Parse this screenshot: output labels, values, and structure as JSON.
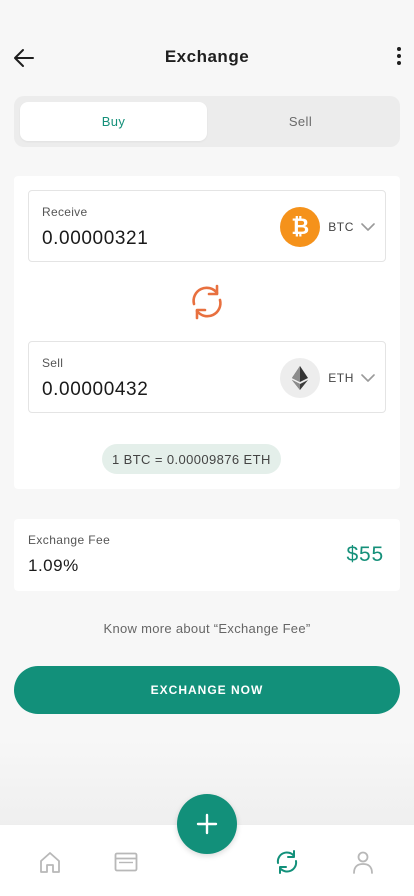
{
  "header": {
    "title": "Exchange",
    "back_icon": "arrow-left-icon",
    "more_icon": "more-vertical-icon"
  },
  "tabs": [
    {
      "label": "Buy",
      "active": true
    },
    {
      "label": "Sell",
      "active": false
    }
  ],
  "receive": {
    "label": "Receive",
    "value": "0.00000321",
    "coin_symbol": "BTC",
    "coin_icon": "bitcoin-icon",
    "coin_glyph": "₿"
  },
  "sell": {
    "label": "Sell",
    "value": "0.00000432",
    "coin_symbol": "ETH",
    "coin_icon": "ethereum-icon"
  },
  "swap_icon": "swap-refresh-icon",
  "rate": "1 BTC = 0.00009876 ETH",
  "fee": {
    "label": "Exchange Fee",
    "rate": "1.09%",
    "amount": "$55"
  },
  "know_more": "Know more about “Exchange Fee”",
  "exchange_button": "EXCHANGE NOW",
  "bottom_nav": {
    "items": [
      {
        "icon": "home-icon",
        "active": false
      },
      {
        "icon": "wallet-card-icon",
        "active": false
      },
      {
        "icon": "exchange-refresh-icon",
        "active": true
      },
      {
        "icon": "profile-icon",
        "active": false
      }
    ],
    "fab_icon": "plus-icon"
  },
  "colors": {
    "accent": "#12907a",
    "accent_text": "#15907a",
    "btc": "#f5921b",
    "swap": "#e8703f",
    "rate_bg": "#e4efea",
    "background": "#f7f7f7"
  }
}
